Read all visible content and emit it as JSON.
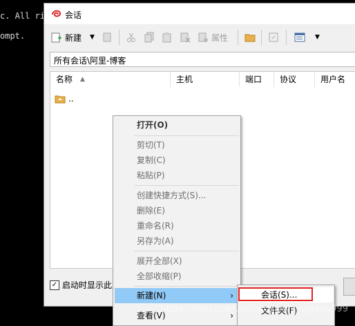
{
  "terminal": {
    "line1": "c. All rig",
    "line2": "ompt."
  },
  "dialog": {
    "title": "会话",
    "toolbar": {
      "new_label": "新建",
      "properties_label": "属性"
    },
    "path": "所有会话\\阿里-博客",
    "columns": [
      "名称",
      "主机",
      "端口",
      "协议",
      "用户名"
    ],
    "parent_row": "..",
    "startup_checkbox_label": "启动时显示此对话框",
    "startup_checked": true
  },
  "context_menu": {
    "items": [
      {
        "label": "打开(O)",
        "style": "bold"
      },
      {
        "label": "剪切(T)",
        "style": "disabled"
      },
      {
        "label": "复制(C)",
        "style": "disabled"
      },
      {
        "label": "粘贴(P)",
        "style": "disabled"
      },
      {
        "label": "创建快捷方式(S)...",
        "style": "disabled"
      },
      {
        "label": "删除(E)",
        "style": "disabled"
      },
      {
        "label": "重命名(R)",
        "style": "disabled"
      },
      {
        "label": "另存为(A)",
        "style": "disabled"
      },
      {
        "label": "展开全部(X)",
        "style": "disabled"
      },
      {
        "label": "全部收缩(P)",
        "style": "disabled"
      },
      {
        "label": "新建(N)",
        "style": "highlight"
      },
      {
        "label": "查看(V)",
        "style": "normal"
      }
    ],
    "submenu": [
      {
        "label": "会话(S)..."
      },
      {
        "label": "文件夹(F)"
      }
    ]
  },
  "watermark": "https://blog.csdn.net/wuxinsh_ngliang999",
  "colors": {
    "highlight": "#91c9f7",
    "annotation_box": "#e32020"
  }
}
